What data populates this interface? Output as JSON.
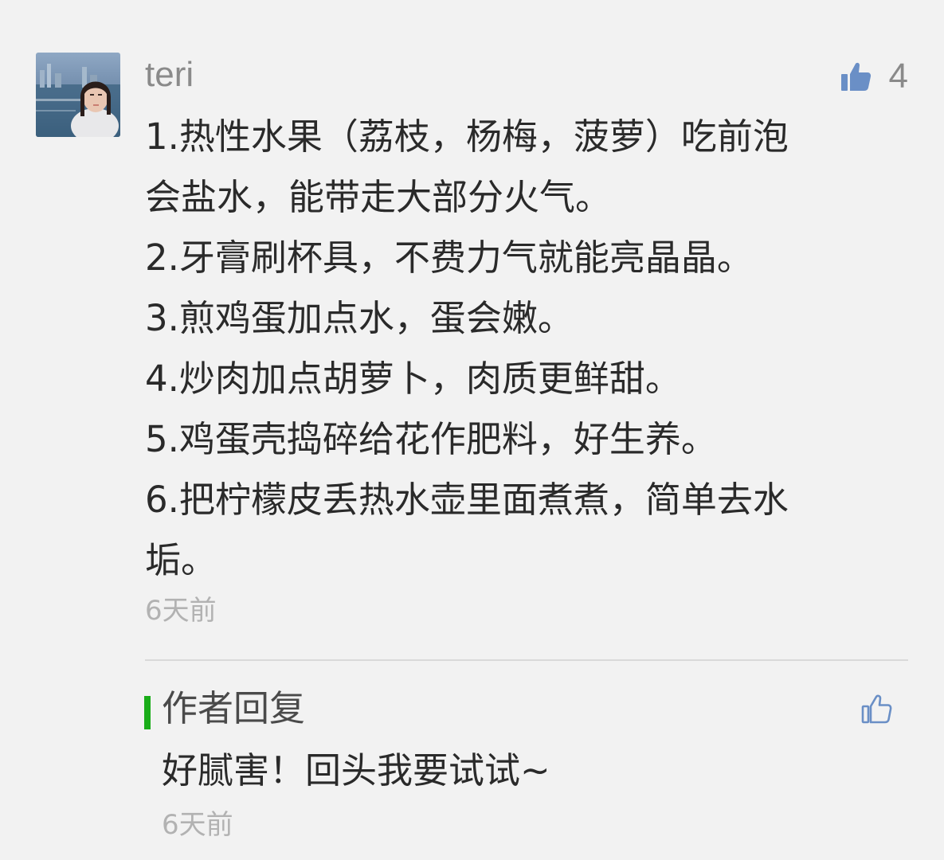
{
  "comment": {
    "username": "teri",
    "like_count": "4",
    "lines": [
      "1.热性水果（荔枝，杨梅，菠萝）吃前泡",
      "会盐水，能带走大部分火气。",
      "2.牙膏刷杯具，不费力气就能亮晶晶。",
      "3.煎鸡蛋加点水，蛋会嫩。",
      "4.炒肉加点胡萝卜，肉质更鲜甜。",
      "5.鸡蛋壳捣碎给花作肥料，好生养。",
      "6.把柠檬皮丢热水壶里面煮煮，简单去水",
      "垢。"
    ],
    "timestamp": "6天前"
  },
  "reply": {
    "title": "作者回复",
    "text": "好腻害！回头我要试试~",
    "timestamp": "6天前"
  },
  "icons": {
    "like": "thumbs-up-icon",
    "reply_like": "thumbs-up-outline-icon"
  },
  "colors": {
    "accent_green": "#1aad19",
    "like_blue": "#6a8fc6",
    "muted_text": "#8a8a8a",
    "timestamp": "#b2b2b2"
  }
}
